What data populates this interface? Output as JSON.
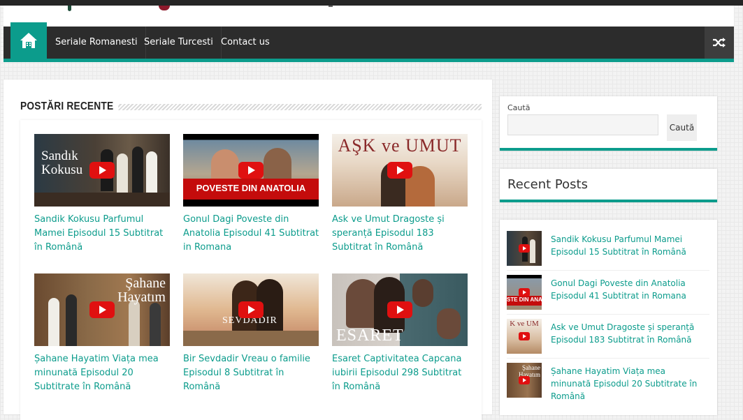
{
  "nav": {
    "items": [
      "Seriale Romanesti",
      "Seriale Turcesti",
      "Contact us"
    ]
  },
  "section": {
    "title": "POSTĂRI RECENTE"
  },
  "posts": [
    {
      "title": "Sandik Kokusu Parfumul Mamei Episodul 15 Subtitrat în Română",
      "thumb_text": "Sandık Kokusu"
    },
    {
      "title": "Gonul Dagi Poveste din Anatolia Episodul 41 Subtitrat in Romana",
      "thumb_text": "POVESTE DIN ANATOLIA"
    },
    {
      "title": "Ask ve Umut Dragoste și speranță Episodul 183 Subtitrat în Română",
      "thumb_text": "AŞK ve UMUT"
    },
    {
      "title": "Șahane Hayatim Viața mea minunată Episodul 20 Subtitrate în Română",
      "thumb_text": "Şahane Hayatım"
    },
    {
      "title": "Bir Sevdadir Vreau o familie Episodul 8 Subtitrat în Română",
      "thumb_text": "SEVDADIR"
    },
    {
      "title": "Esaret Captivitatea Capcana iubirii Episodul 298 Subtitrat în Română",
      "thumb_text": "ESARET"
    }
  ],
  "search": {
    "label": "Caută",
    "button": "Caută"
  },
  "recent_posts": {
    "title": "Recent Posts",
    "items": [
      {
        "title": "Sandik Kokusu Parfumul Mamei Episodul 15 Subtitrat în Română"
      },
      {
        "title": "Gonul Dagi Poveste din Anatolia Episodul 41 Subtitrat in Romana",
        "thumb_text": "STE DIN ANAT"
      },
      {
        "title": "Ask ve Umut Dragoste și speranță Episodul 183 Subtitrat în Română",
        "thumb_text": "K ve UM"
      },
      {
        "title": "Șahane Hayatim Viața mea minunată Episodul 20 Subtitrate în Română",
        "thumb_text": "Şahane Hayatım"
      }
    ]
  },
  "colors": {
    "accent": "#0c9c8c",
    "nav_bg": "#2c2c2c",
    "play_red": "#e01010"
  }
}
